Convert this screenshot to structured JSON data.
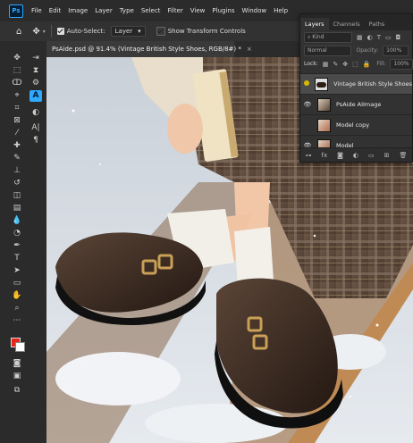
{
  "menu": [
    "File",
    "Edit",
    "Image",
    "Layer",
    "Type",
    "Select",
    "Filter",
    "View",
    "Plugins",
    "Window",
    "Help"
  ],
  "app_logo": "Ps",
  "options": {
    "auto_select_label": "Auto-Select:",
    "auto_select_value": "Layer",
    "transform_label": "Show Transform Controls"
  },
  "document": {
    "tab_title": "PsAide.psd @ 91.4% (Vintage British Style Shoes, RGB/8#) *",
    "close": "×"
  },
  "layers_panel": {
    "tabs": [
      "Layers",
      "Channels",
      "Paths"
    ],
    "filter_kind": "Kind",
    "blend_mode": "Normal",
    "opacity_label": "Opacity:",
    "opacity_value": "100%",
    "lock_label": "Lock:",
    "fill_label": "Fill:",
    "fill_value": "100%",
    "layers": [
      {
        "name": "Vintage British Style Shoes",
        "visible": false,
        "selected": true
      },
      {
        "name": "PsAide AIImage",
        "visible": true,
        "selected": false
      },
      {
        "name": "Model copy",
        "visible": false,
        "selected": false
      },
      {
        "name": "Model",
        "visible": true,
        "selected": false
      }
    ]
  },
  "colors": {
    "foreground": "#e8251a",
    "background": "#ffffff",
    "accent": "#31a8ff"
  }
}
